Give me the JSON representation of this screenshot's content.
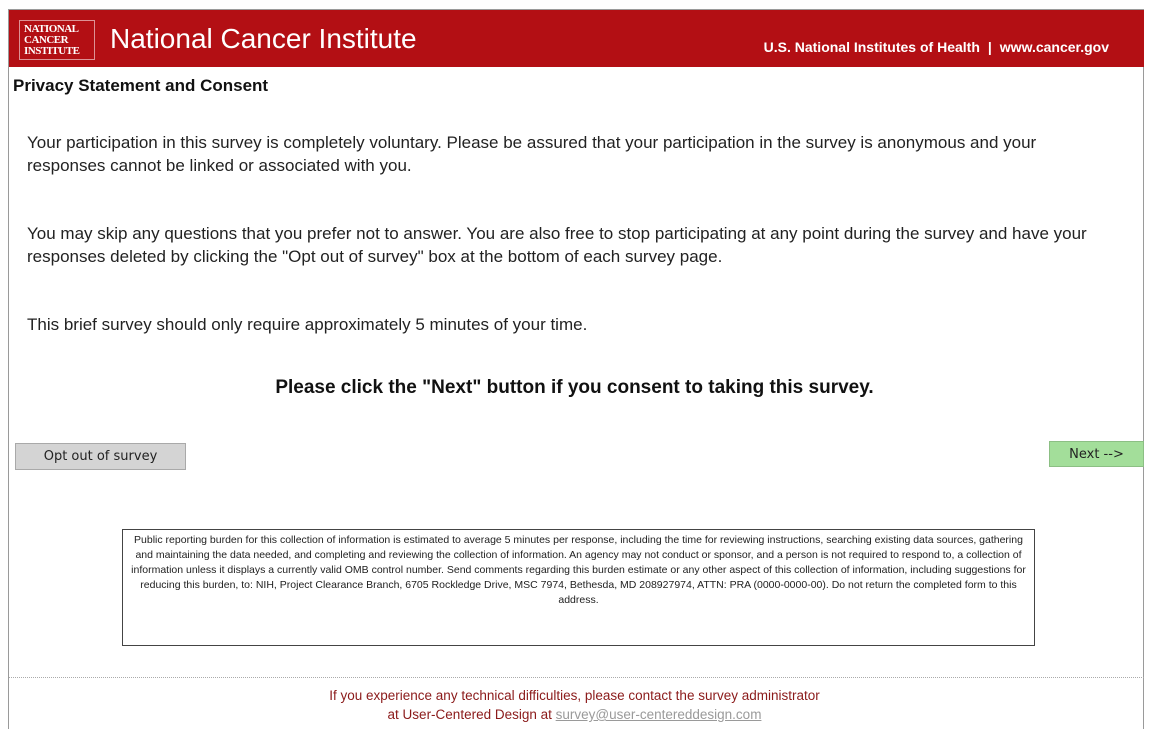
{
  "header": {
    "logo_lines": [
      "NATIONAL",
      "CANCER",
      "INSTITUTE"
    ],
    "title": "National Cancer Institute",
    "link_nih": "U.S. National Institutes of Health",
    "separator": "|",
    "link_site": "www.cancer.gov"
  },
  "page_title": "Privacy Statement and Consent",
  "paragraphs": [
    "Your participation in this survey is completely voluntary. Please be assured that your participation in the survey is anonymous and your responses cannot be linked or associated with you.",
    "You may skip any questions that you prefer not to answer. You are also free to stop participating at any point during the survey and have your responses deleted by clicking the \"Opt out of survey\" box at the bottom of each survey page.",
    "This brief survey should only require approximately 5 minutes of your time."
  ],
  "consent_text": "Please click the \"Next\" button if you consent to taking this survey.",
  "buttons": {
    "opt_out": "Opt out of survey",
    "next": "Next -->"
  },
  "burden_statement": "Public reporting burden for this collection of information is estimated to average 5 minutes per response, including the time for reviewing instructions, searching existing data sources, gathering and maintaining the data needed, and completing and reviewing the collection of information. An agency may not conduct or sponsor, and a person is not required to respond to, a collection of information unless it displays a currently valid OMB control number. Send comments regarding this burden estimate or any other aspect of this collection of information, including suggestions for reducing this burden, to: NIH, Project Clearance Branch, 6705 Rockledge Drive, MSC 7974, Bethesda, MD 208927974, ATTN: PRA (0000-0000-00). Do not return the completed form to this address.",
  "footer": {
    "line1": "If you experience any technical difficulties, please contact the survey administrator",
    "line2_prefix": "at User-Centered Design at",
    "email": "survey@user-centereddesign.com"
  },
  "colors": {
    "banner": "#b30f14",
    "next_button": "#a3de9a",
    "opt_out_button": "#d4d4d4",
    "footer_text": "#8b1a1a"
  }
}
